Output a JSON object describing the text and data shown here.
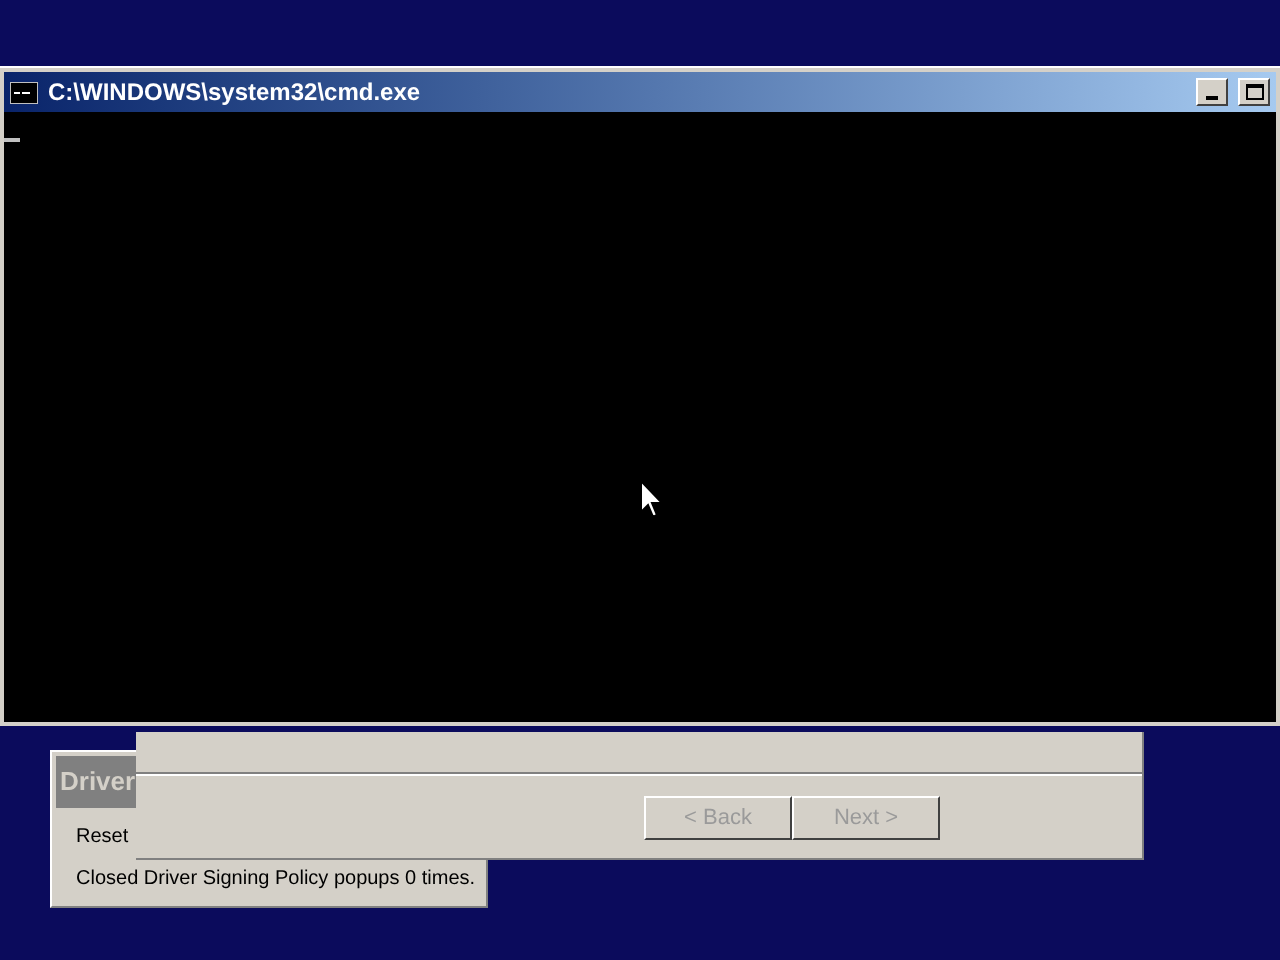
{
  "console_window": {
    "title": "C:\\WINDOWS\\system32\\cmd.exe",
    "cursor_visible": true
  },
  "driver_dialog": {
    "title": "Driver",
    "lines": [
      "Reset",
      "Closed Driver Signing Policy popups 0 times."
    ]
  },
  "wizard": {
    "buttons": [
      {
        "label": "< Back",
        "disabled": true
      },
      {
        "label": "Next >",
        "disabled": true
      }
    ]
  }
}
